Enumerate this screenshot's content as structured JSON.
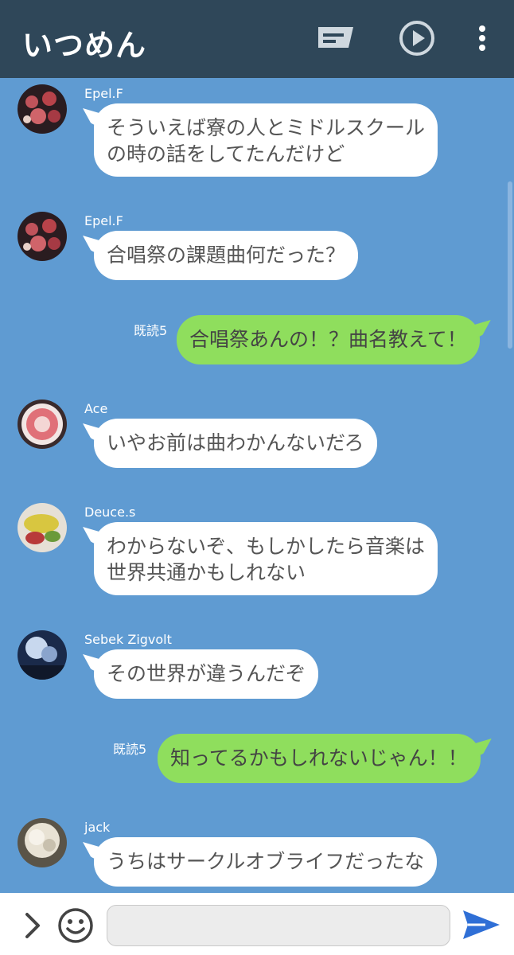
{
  "header": {
    "title": "いつめん",
    "icons": [
      "note-icon",
      "play-circle-icon",
      "more-vert-icon"
    ]
  },
  "messages": [
    {
      "type": "incoming",
      "sender": "Epel.F",
      "avatar": "meat-avatar",
      "lines": [
        "そういえば寮の人とミドルスクール",
        "の時の話をしてたんだけど"
      ]
    },
    {
      "type": "incoming",
      "sender": "Epel.F",
      "avatar": "meat-avatar",
      "lines": [
        "合唱祭の課題曲何だった？"
      ]
    },
    {
      "type": "outgoing",
      "read": "既読5",
      "lines": [
        "合唱祭あんの！？曲名教えて！"
      ]
    },
    {
      "type": "incoming",
      "sender": "Ace",
      "avatar": "plate-avatar",
      "lines": [
        "いやお前は曲わかんないだろ"
      ]
    },
    {
      "type": "incoming",
      "sender": "Deuce.s",
      "avatar": "omelette-avatar",
      "lines": [
        "わからないぞ、もしかしたら音楽は",
        "世界共通かもしれない"
      ]
    },
    {
      "type": "incoming",
      "sender": "Sebek Zigvolt",
      "avatar": "sky-avatar",
      "lines": [
        "その世界が違うんだぞ"
      ]
    },
    {
      "type": "outgoing",
      "read": "既読5",
      "lines": [
        "知ってるかもしれないじゃん！！"
      ]
    },
    {
      "type": "incoming",
      "sender": "jack",
      "avatar": "fur-avatar",
      "lines": [
        "うちはサークルオブライフだったな"
      ]
    }
  ],
  "input": {
    "placeholder": ""
  },
  "colors": {
    "header_bg": "#2f4759",
    "chat_bg": "#5f9bd2",
    "incoming_bubble": "#ffffff",
    "outgoing_bubble": "#8fde5d",
    "send_accent": "#2f6fd6"
  }
}
